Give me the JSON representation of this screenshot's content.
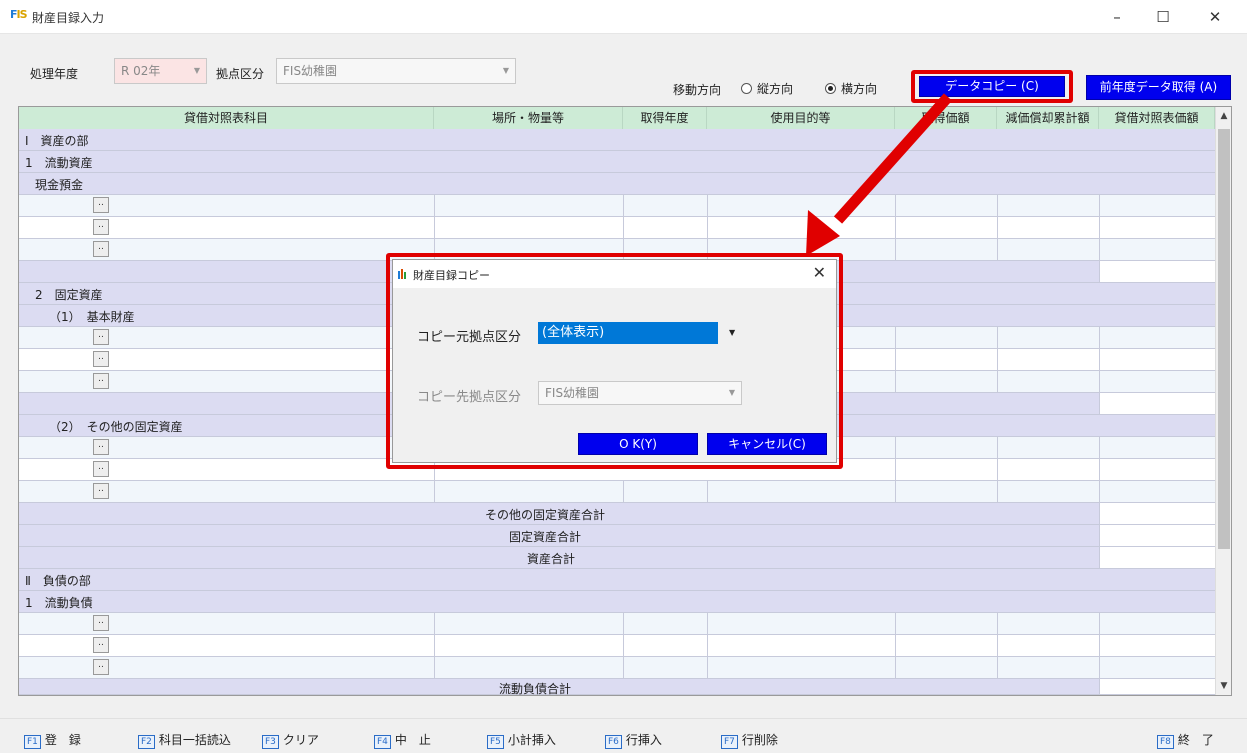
{
  "window": {
    "title": "財産目録入力",
    "logo": "FIS",
    "minimize": "–",
    "maximize": "☐",
    "close": "✕"
  },
  "filter": {
    "year_label": "処理年度",
    "year_value": "R 02年",
    "base_label": "拠点区分",
    "base_value": "FIS幼稚園",
    "direction_label": "移動方向",
    "vertical": "縦方向",
    "horizontal": "横方向",
    "selected": "横方向"
  },
  "buttons": {
    "data_copy": "データコピー (C)",
    "prev_year": "前年度データ取得 (A)"
  },
  "grid": {
    "headers": [
      "貸借対照表科目",
      "場所・物量等",
      "取得年度",
      "使用目的等",
      "取得価額",
      "減価償却累計額",
      "貸借対照表価額"
    ],
    "rows": {
      "r0": "Ⅰ　資産の部",
      "r1": "1　流動資産",
      "r2": "現金預金",
      "r7": "2　固定資産",
      "r8": "（1）　基本財産",
      "r13": "（2）　その他の固定資産",
      "r17": "その他の固定資産合計",
      "r18": "固定資産合計",
      "r19": "資産合計",
      "r20": "Ⅱ　負債の部",
      "r21": "1　流動負債",
      "r25": "流動負債合計"
    },
    "expand_label": ".."
  },
  "dialog": {
    "title": "財産目録コピー",
    "close": "✕",
    "source_label": "コピー元拠点区分",
    "source_value": "(全体表示)",
    "dest_label": "コピー先拠点区分",
    "dest_value": "FIS幼稚園",
    "ok": "O  K(Y)",
    "cancel": "キャンセル(C)"
  },
  "fkeys": [
    {
      "key": "F1",
      "label": "登　録"
    },
    {
      "key": "F2",
      "label": "科目一括読込"
    },
    {
      "key": "F3",
      "label": "クリア"
    },
    {
      "key": "F4",
      "label": "中　止"
    },
    {
      "key": "F5",
      "label": "小計挿入"
    },
    {
      "key": "F6",
      "label": "行挿入"
    },
    {
      "key": "F7",
      "label": "行削除"
    },
    {
      "key": "F8",
      "label": "終　了"
    }
  ],
  "colors": {
    "accent_blue": "#0000ee",
    "highlight_red": "#e00000",
    "header_green": "#cdebd6",
    "section_lavender": "#dcdcf2"
  }
}
